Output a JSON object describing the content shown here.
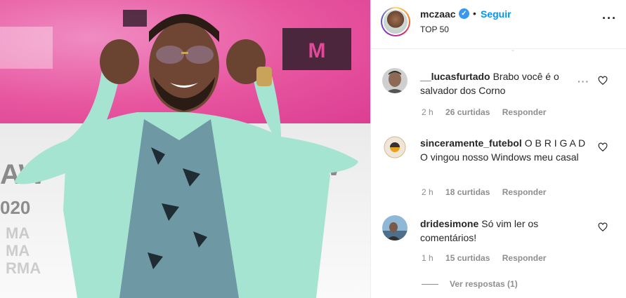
{
  "photo": {
    "alt": "Homem sorrindo com óculos de sol e jaqueta verde-menta em frente a painel MTV",
    "logo_text": "MTV"
  },
  "header": {
    "username": "mczaac",
    "dot": "•",
    "follow_label": "Seguir",
    "subtitle": "TOP 50",
    "verified_icon": "verified-badge-icon",
    "more_icon": "more-options-icon"
  },
  "comments": [
    {
      "username": "__lucasfurtado",
      "text": "Brabo você é o salvador dos Corno",
      "time": "2 h",
      "likes": "26 curtidas",
      "reply_label": "Responder"
    },
    {
      "username": "sinceramente_futebol",
      "text": "O B R I G A D O vingou nosso Windows meu casal",
      "time": "2 h",
      "likes": "18 curtidas",
      "reply_label": "Responder"
    },
    {
      "username": "dridesimone",
      "text": "Só vim ler os comentários!",
      "time": "1 h",
      "likes": "15 curtidas",
      "reply_label": "Responder"
    }
  ],
  "view_replies": "Ver respostas (1)",
  "colors": {
    "accent": "#0095f6",
    "muted": "#8e8e8e",
    "text": "#262626",
    "backdrop_pink": "#e2489a",
    "jacket": "#9fe3cf"
  }
}
